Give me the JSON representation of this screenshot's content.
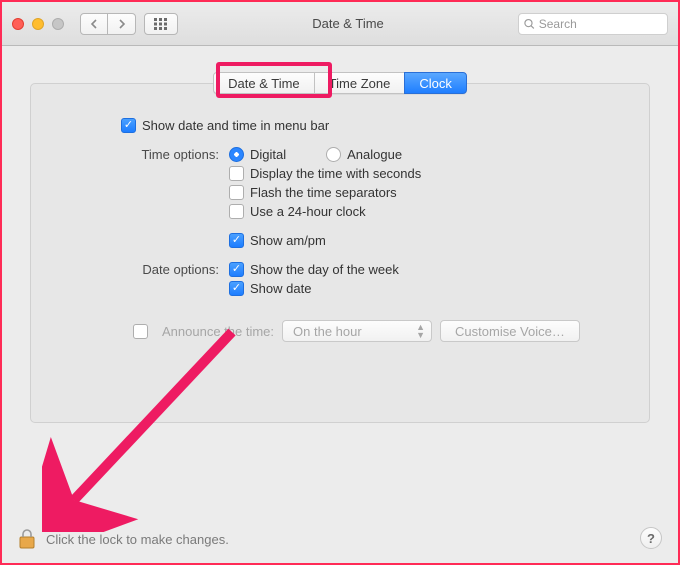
{
  "toolbar": {
    "title": "Date & Time",
    "search_placeholder": "Search"
  },
  "tabs": [
    "Date & Time",
    "Time Zone",
    "Clock"
  ],
  "selected_tab_index": 2,
  "highlighted_tab_index": 0,
  "main": {
    "show_in_menu_bar": {
      "label": "Show date and time in menu bar",
      "checked": true
    },
    "time_options_label": "Time options:",
    "time_format": {
      "digital": "Digital",
      "analogue": "Analogue",
      "value": "digital"
    },
    "display_seconds": {
      "label": "Display the time with seconds",
      "checked": false
    },
    "flash_separators": {
      "label": "Flash the time separators",
      "checked": false
    },
    "use_24h": {
      "label": "Use a 24-hour clock",
      "checked": false
    },
    "show_ampm": {
      "label": "Show am/pm",
      "checked": true
    },
    "date_options_label": "Date options:",
    "show_day": {
      "label": "Show the day of the week",
      "checked": true
    },
    "show_date": {
      "label": "Show date",
      "checked": true
    },
    "announce": {
      "label": "Announce the time:",
      "checked": false,
      "interval": "On the hour",
      "customise": "Customise Voice…"
    }
  },
  "footer": {
    "lock_text": "Click the lock to make changes.",
    "help": "?"
  }
}
